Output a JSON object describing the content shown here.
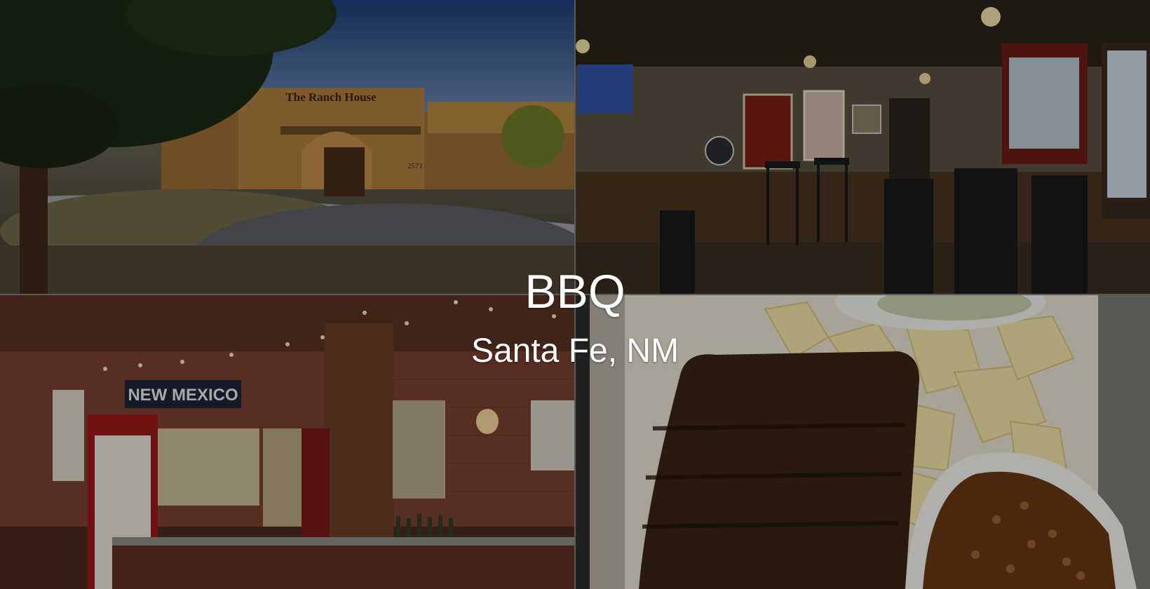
{
  "hero": {
    "title": "BBQ",
    "subtitle": "Santa Fe, NM"
  },
  "photos": {
    "exterior": {
      "sign_text": "The Ranch House",
      "address_number": "2571"
    },
    "store": {
      "sign_text": "NEW MEXICO"
    }
  }
}
